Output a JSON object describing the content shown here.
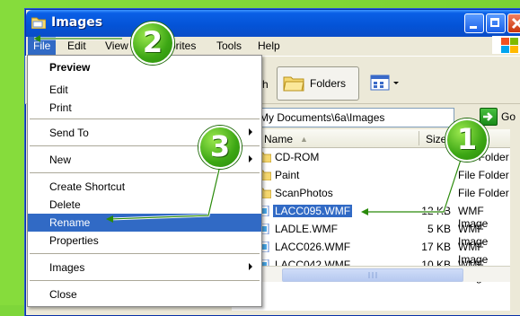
{
  "window": {
    "title": "Images"
  },
  "menubar": {
    "items": [
      "File",
      "Edit",
      "View",
      "Favorites",
      "Tools",
      "Help"
    ]
  },
  "toolbar": {
    "back_partial": "h",
    "folders_label": "Folders"
  },
  "address": {
    "path": "My Documents\\6a\\Images",
    "go_label": "Go"
  },
  "columns": {
    "name": "Name",
    "size": "Size"
  },
  "files": [
    {
      "name": "CD-ROM",
      "size": "",
      "type": "File Folder",
      "kind": "folder"
    },
    {
      "name": "Paint",
      "size": "",
      "type": "File Folder",
      "kind": "folder"
    },
    {
      "name": "ScanPhotos",
      "size": "",
      "type": "File Folder",
      "kind": "folder"
    },
    {
      "name": "LACC095.WMF",
      "size": "12 KB",
      "type": "WMF Image",
      "kind": "wmf",
      "selected": true
    },
    {
      "name": "LADLE.WMF",
      "size": "5 KB",
      "type": "WMF Image",
      "kind": "wmf"
    },
    {
      "name": "LACC026.WMF",
      "size": "17 KB",
      "type": "WMF Image",
      "kind": "wmf"
    },
    {
      "name": "LACC042.WMF",
      "size": "10 KB",
      "type": "WMF Image",
      "kind": "wmf"
    }
  ],
  "file_menu": {
    "items": [
      {
        "label": "Preview",
        "bold": true
      },
      {
        "label": "Edit"
      },
      {
        "label": "Print"
      },
      {
        "label": "Send To",
        "submenu": true
      },
      {
        "label": "New",
        "submenu": true
      },
      {
        "label": "Create Shortcut"
      },
      {
        "label": "Delete"
      },
      {
        "label": "Rename",
        "highlighted": true
      },
      {
        "label": "Properties"
      },
      {
        "label": "Images",
        "submenu": true
      },
      {
        "label": "Close"
      }
    ]
  },
  "callouts": [
    "1",
    "2",
    "3"
  ],
  "colors": {
    "background": "#7ed63a",
    "selection": "#316ac5",
    "callout": "#3ca614",
    "titlebar": "#0a5fe6"
  }
}
